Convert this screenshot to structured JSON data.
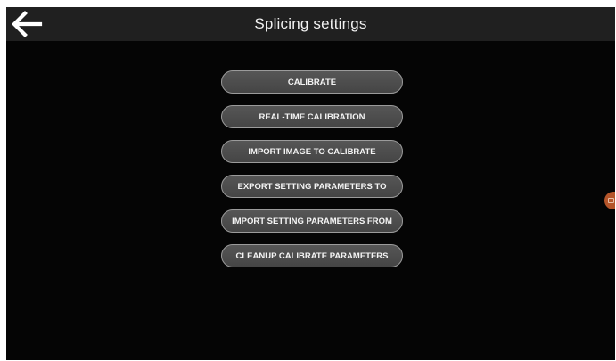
{
  "header": {
    "title": "Splicing settings",
    "back_icon": "arrow-left-icon"
  },
  "menu": {
    "items": [
      {
        "id": "calibrate",
        "label": "CALIBRATE"
      },
      {
        "id": "real-time-calibration",
        "label": "REAL-TIME CALIBRATION"
      },
      {
        "id": "import-image-to-calibrate",
        "label": "IMPORT IMAGE TO CALIBRATE"
      },
      {
        "id": "export-setting-parameters-to",
        "label": "EXPORT SETTING PARAMETERS TO"
      },
      {
        "id": "import-setting-parameters-from",
        "label": "IMPORT SETTING PARAMETERS FROM"
      },
      {
        "id": "cleanup-calibrate-parameters",
        "label": "CLEANUP CALIBRATE PARAMETERS"
      }
    ]
  },
  "side_handle": {
    "icon": "camera-icon",
    "color": "#b5552a"
  },
  "colors": {
    "background": "#050505",
    "topbar": "#202020",
    "button_fill": "#4d4d4d",
    "button_border": "#9b9b9b",
    "text": "#f2f2f2"
  }
}
